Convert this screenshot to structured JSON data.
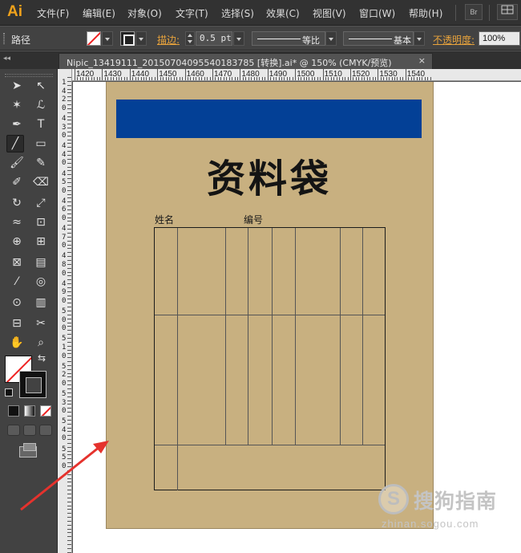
{
  "app": {
    "logo": "Ai",
    "bridge_label": "Br"
  },
  "menu": [
    "文件(F)",
    "编辑(E)",
    "对象(O)",
    "文字(T)",
    "选择(S)",
    "效果(C)",
    "视图(V)",
    "窗口(W)",
    "帮助(H)"
  ],
  "control_bar": {
    "selection_label": "路径",
    "stroke_label": "描边:",
    "stroke_weight": "0.5 pt",
    "stroke_profile": "等比",
    "brush_style": "基本",
    "opacity_label": "不透明度:",
    "opacity_value": "100%"
  },
  "document_tab": {
    "title": "Nipic_13419111_20150704095540183785 [转换].ai* @ 150% (CMYK/预览)",
    "close_glyph": "×"
  },
  "panel_collapse_glyph": "◂◂",
  "ruler": {
    "h_labels": [
      "1420",
      "1430",
      "1440",
      "1450",
      "1460",
      "1470",
      "1480",
      "1490",
      "1500",
      "1510",
      "1520",
      "1530",
      "1540"
    ],
    "v_labels": [
      "1",
      "4",
      "2",
      "0",
      "4",
      "3",
      "0",
      "4",
      "4",
      "0",
      "4",
      "5",
      "0",
      "4",
      "6",
      "0",
      "4",
      "7",
      "0",
      "4",
      "8",
      "0",
      "4",
      "9",
      "0",
      "5",
      "0",
      "0",
      "5",
      "1",
      "0",
      "5",
      "2",
      "0",
      "5",
      "3",
      "0",
      "5",
      "4",
      "0",
      "5",
      "5",
      "0"
    ]
  },
  "tools": {
    "selection": "➤",
    "direct_select": "↖",
    "magic_wand": "✶",
    "lasso": "ℒ",
    "pen": "✒",
    "type": "T",
    "line": "╱",
    "rectangle": "▭",
    "paintbrush": "🖌",
    "pencil": "✎",
    "blob_brush": "✐",
    "eraser": "⌫",
    "rotate": "↻",
    "scale": "⤢",
    "warp": "≈",
    "free_transform": "⊡",
    "shape_builder": "⊕",
    "perspective": "⊞",
    "mesh": "⊠",
    "gradient": "▤",
    "eyedropper": "⁄",
    "blend": "◎",
    "symbol_sprayer": "⊙",
    "graph": "▥",
    "artboard": "⊟",
    "slice": "✂",
    "hand": "✋",
    "zoom": "⌕",
    "swap_glyph": "⇆"
  },
  "artwork": {
    "title": "资料袋",
    "name_label": "姓名",
    "number_label": "编号",
    "bag_color": "#c8b080",
    "band_color": "#034096"
  },
  "watermark": {
    "glyph": "S",
    "brand": "搜狗指南",
    "url": "zhinan.sogou.com"
  },
  "colors": {
    "arrow": "#e5322d"
  }
}
